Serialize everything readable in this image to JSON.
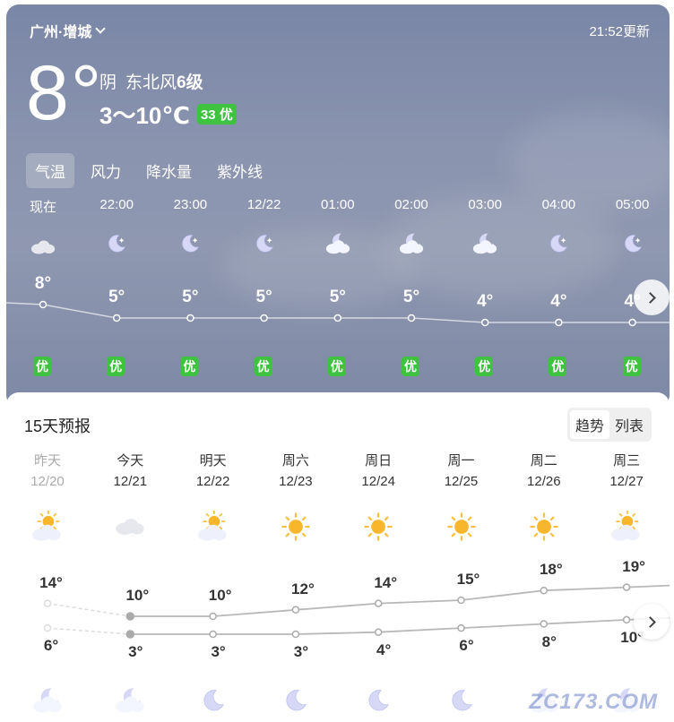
{
  "header": {
    "location": "广州·增城",
    "update_time": "21:52更新"
  },
  "current": {
    "temp": "8°",
    "condition": "阴",
    "wind": "东北风",
    "wind_level": "6级",
    "range": "3～10℃",
    "aqi": "33 优"
  },
  "tabs": [
    {
      "label": "气温",
      "active": true
    },
    {
      "label": "风力",
      "active": false
    },
    {
      "label": "降水量",
      "active": false
    },
    {
      "label": "紫外线",
      "active": false
    }
  ],
  "hourly": [
    {
      "time": "现在",
      "icon": "cloud-icon",
      "temp": 8,
      "temp_label": "8°",
      "quality": "优"
    },
    {
      "time": "22:00",
      "icon": "moon-icon",
      "temp": 5,
      "temp_label": "5°",
      "quality": "优"
    },
    {
      "time": "23:00",
      "icon": "moon-icon",
      "temp": 5,
      "temp_label": "5°",
      "quality": "优"
    },
    {
      "time": "12/22",
      "icon": "moon-icon",
      "temp": 5,
      "temp_label": "5°",
      "quality": "优"
    },
    {
      "time": "01:00",
      "icon": "moon-cloud-icon",
      "temp": 5,
      "temp_label": "5°",
      "quality": "优"
    },
    {
      "time": "02:00",
      "icon": "moon-cloud-icon",
      "temp": 5,
      "temp_label": "5°",
      "quality": "优"
    },
    {
      "time": "03:00",
      "icon": "moon-cloud-icon",
      "temp": 4,
      "temp_label": "4°",
      "quality": "优"
    },
    {
      "time": "04:00",
      "icon": "moon-icon",
      "temp": 4,
      "temp_label": "4°",
      "quality": "优"
    },
    {
      "time": "05:00",
      "icon": "moon-icon",
      "temp": 4,
      "temp_label": "4°",
      "quality": "优"
    }
  ],
  "forecast": {
    "title": "15天预报",
    "toggle": [
      "趋势",
      "列表"
    ],
    "days": [
      {
        "name": "昨天",
        "date": "12/20",
        "icon": "sun-cloud-icon",
        "high": 14,
        "high_label": "14°",
        "low": 6,
        "low_label": "6°",
        "night_icon": "moon-cloud-icon",
        "past": true
      },
      {
        "name": "今天",
        "date": "12/21",
        "icon": "cloud-icon",
        "high": 10,
        "high_label": "10°",
        "low": 3,
        "low_label": "3°",
        "night_icon": "moon-cloud-icon",
        "past": false
      },
      {
        "name": "明天",
        "date": "12/22",
        "icon": "sun-cloud-icon",
        "high": 10,
        "high_label": "10°",
        "low": 3,
        "low_label": "3°",
        "night_icon": "moon-icon",
        "past": false
      },
      {
        "name": "周六",
        "date": "12/23",
        "icon": "sun-icon",
        "high": 12,
        "high_label": "12°",
        "low": 3,
        "low_label": "3°",
        "night_icon": "moon-icon",
        "past": false
      },
      {
        "name": "周日",
        "date": "12/24",
        "icon": "sun-icon",
        "high": 14,
        "high_label": "14°",
        "low": 4,
        "low_label": "4°",
        "night_icon": "moon-icon",
        "past": false
      },
      {
        "name": "周一",
        "date": "12/25",
        "icon": "sun-icon",
        "high": 15,
        "high_label": "15°",
        "low": 6,
        "low_label": "6°",
        "night_icon": "moon-icon",
        "past": false
      },
      {
        "name": "周二",
        "date": "12/26",
        "icon": "sun-icon",
        "high": 18,
        "high_label": "18°",
        "low": 8,
        "low_label": "8°",
        "night_icon": "moon-cloud-icon",
        "past": false
      },
      {
        "name": "周三",
        "date": "12/27",
        "icon": "sun-cloud-icon",
        "high": 19,
        "high_label": "19°",
        "low": 10,
        "low_label": "10°",
        "night_icon": "moon-cloud-icon",
        "past": false
      }
    ]
  },
  "watermark": "ZC173.COM"
}
